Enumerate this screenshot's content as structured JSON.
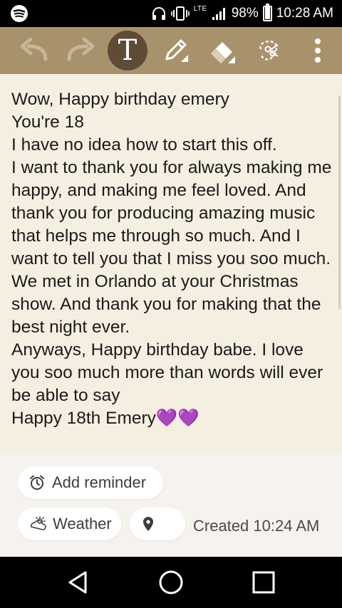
{
  "status_bar": {
    "battery": "98%",
    "battery_level": 0.98,
    "time": "10:28 AM",
    "network_label": "LTE",
    "icons": [
      "spotify-icon",
      "headphones-icon",
      "vibrate-icon",
      "lte-icon",
      "signal-icon",
      "battery-icon"
    ]
  },
  "toolbar": {
    "icons": [
      "undo-icon",
      "redo-icon",
      "text-mode-icon",
      "pen-icon",
      "eraser-icon",
      "lasso-cut-icon",
      "more-vert-icon"
    ],
    "text_mode_glyph": "T",
    "colors": {
      "toolbar_bg": "#a8926c",
      "active_bg": "#5e4c39"
    }
  },
  "note": {
    "text": "Wow, Happy birthday emery\nYou're 18\nI have no idea how to start this off.\nI want to thank you for always making me happy, and making me feel loved. And thank you for producing amazing music that helps me through so much. And I want to tell you that I miss you soo much. We met in Orlando at your Christmas show. And thank you for making that the best night ever.\nAnyways, Happy birthday babe. I love you soo much more than words will ever be able to say\nHappy 18th Emery💜💜",
    "background": "#f5efe1"
  },
  "info": {
    "reminder_label": "Add reminder",
    "weather_label": "Weather",
    "location_value": "",
    "created_label": "Created 10:24 AM"
  },
  "nav": {
    "icons": [
      "back-icon",
      "home-icon",
      "recents-icon"
    ]
  }
}
